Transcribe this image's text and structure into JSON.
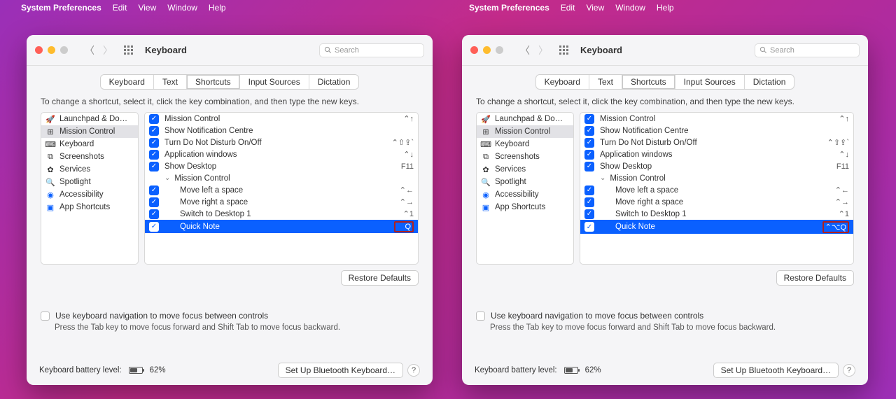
{
  "menubar": {
    "app_title": "System Preferences",
    "items": [
      "Edit",
      "View",
      "Window",
      "Help"
    ]
  },
  "window": {
    "title": "Keyboard",
    "search_placeholder": "Search",
    "tabs": [
      "Keyboard",
      "Text",
      "Shortcuts",
      "Input Sources",
      "Dictation"
    ],
    "active_tab": 2,
    "instruction": "To change a shortcut, select it, click the key combination, and then type the new keys.",
    "sidebar": [
      {
        "icon": "launchpad",
        "label": "Launchpad & Do…"
      },
      {
        "icon": "mission",
        "label": "Mission Control",
        "selected": true
      },
      {
        "icon": "keyboard",
        "label": "Keyboard"
      },
      {
        "icon": "screenshot",
        "label": "Screenshots"
      },
      {
        "icon": "services",
        "label": "Services"
      },
      {
        "icon": "spotlight",
        "label": "Spotlight"
      },
      {
        "icon": "accessibility",
        "label": "Accessibility"
      },
      {
        "icon": "appshortcuts",
        "label": "App Shortcuts"
      }
    ],
    "list": [
      {
        "checked": true,
        "label": "Mission Control",
        "shortcut": "⌃↑"
      },
      {
        "checked": true,
        "label": "Show Notification Centre",
        "shortcut": ""
      },
      {
        "checked": true,
        "label": "Turn Do Not Disturb On/Off",
        "shortcut": "⌃⇧⇪`"
      },
      {
        "checked": true,
        "label": "Application windows",
        "shortcut": "⌃↓"
      },
      {
        "checked": true,
        "label": "Show Desktop",
        "shortcut": "F11"
      },
      {
        "group": true,
        "label": "Mission Control"
      },
      {
        "checked": true,
        "child": true,
        "label": "Move left a space",
        "shortcut": "⌃←"
      },
      {
        "checked": true,
        "child": true,
        "label": "Move right a space",
        "shortcut": "⌃→"
      },
      {
        "checked": true,
        "child": true,
        "label": "Switch to Desktop 1",
        "shortcut": "⌃1"
      }
    ],
    "quick_note": {
      "label": "Quick Note"
    },
    "restore_btn": "Restore Defaults",
    "kbnav_label": "Use keyboard navigation to move focus between controls",
    "kbnav_sub": "Press the Tab key to move focus forward and Shift Tab to move focus backward.",
    "battery_label": "Keyboard battery level:",
    "battery_pct": "62%",
    "bt_btn": "Set Up Bluetooth Keyboard…"
  },
  "variants": {
    "left_quick_note_shortcut": "Q",
    "right_quick_note_shortcut": "⌃⌥Q"
  }
}
